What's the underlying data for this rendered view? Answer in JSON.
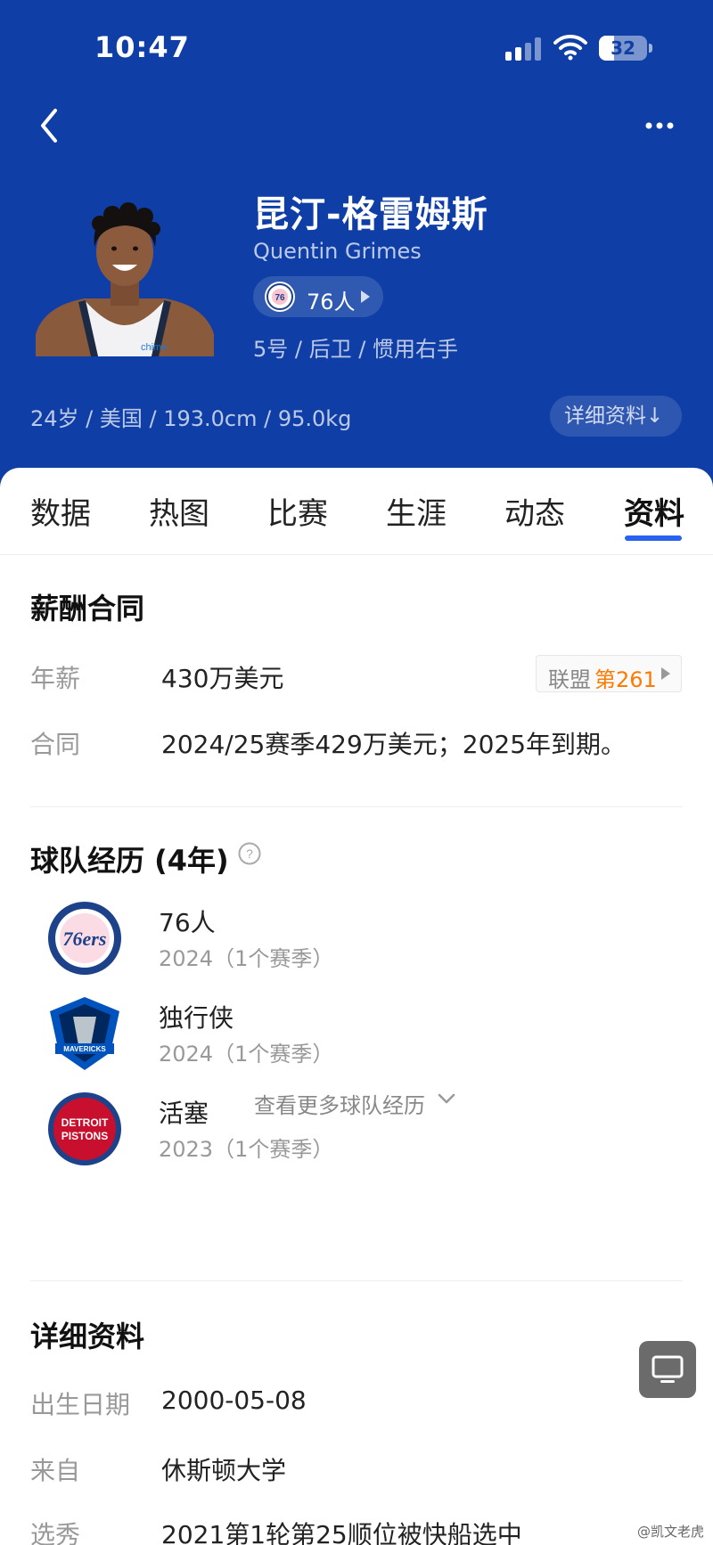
{
  "status_bar": {
    "time": "10:47",
    "battery": "32",
    "battery_level": 0.32
  },
  "header": {
    "player_name_cn": "昆汀-格雷姆斯",
    "player_name_en": "Quentin Grimes",
    "team_name": "76人",
    "meta": "5号 / 后卫 / 惯用右手",
    "bio": "24岁 / 美国 / 193.0cm / 95.0kg",
    "detail_button": "详细资料↓"
  },
  "tabs": [
    {
      "label": "数据",
      "active": false
    },
    {
      "label": "热图",
      "active": false
    },
    {
      "label": "比赛",
      "active": false
    },
    {
      "label": "生涯",
      "active": false
    },
    {
      "label": "动态",
      "active": false
    },
    {
      "label": "资料",
      "active": true
    }
  ],
  "salary": {
    "title": "薪酬合同",
    "annual_label": "年薪",
    "annual_value": "430万美元",
    "rank_prefix": "联盟",
    "rank_value": "第261",
    "contract_label": "合同",
    "contract_value": "2024/25赛季429万美元；2025年到期。"
  },
  "history": {
    "title": "球队经历 (4年)",
    "teams": [
      {
        "name": "76人",
        "years": "2024（1个赛季）",
        "logo_icon": "76ers-logo-icon"
      },
      {
        "name": "独行侠",
        "years": "2024（1个赛季）",
        "logo_icon": "mavericks-logo-icon"
      },
      {
        "name": "活塞",
        "years": "2023（1个赛季）",
        "logo_icon": "pistons-logo-icon"
      }
    ],
    "more_label": "查看更多球队经历"
  },
  "details": {
    "title": "详细资料",
    "rows": [
      {
        "label": "出生日期",
        "value": "2000-05-08"
      },
      {
        "label": "来自",
        "value": "休斯顿大学"
      },
      {
        "label": "选秀",
        "value": "2021第1轮第25顺位被快船选中"
      }
    ]
  },
  "watermark": "@凯文老虎",
  "colors": {
    "header_bg": "#0f3fa6",
    "accent": "#2a62f0",
    "rank_orange": "#ff7a00"
  }
}
